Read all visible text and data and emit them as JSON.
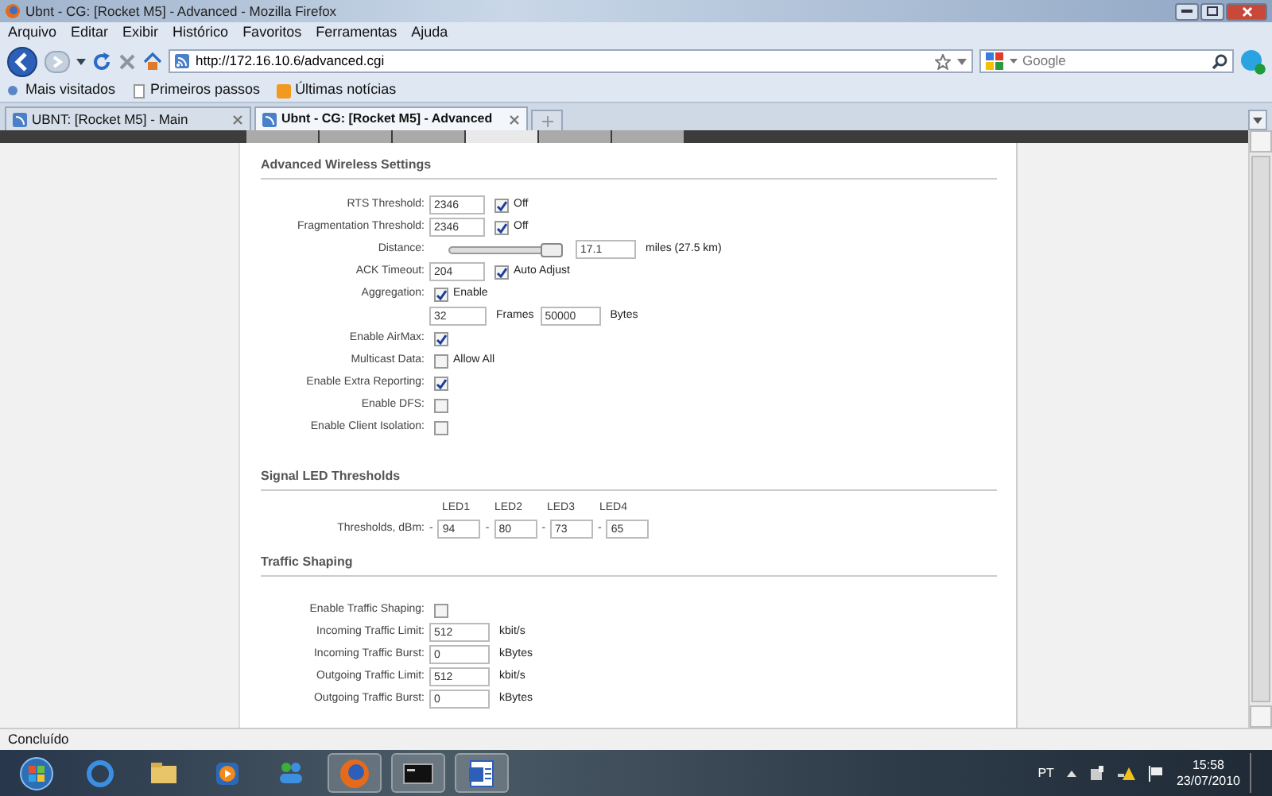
{
  "window": {
    "title": "Ubnt - CG: [Rocket M5] - Advanced - Mozilla Firefox"
  },
  "menu": [
    "Arquivo",
    "Editar",
    "Exibir",
    "Histórico",
    "Favoritos",
    "Ferramentas",
    "Ajuda"
  ],
  "navbar": {
    "url": "http://172.16.10.6/advanced.cgi",
    "search_placeholder": "Google"
  },
  "bookmarks": [
    "Mais visitados",
    "Primeiros passos",
    "Últimas notícias"
  ],
  "browser_tabs": [
    {
      "label": "UBNT: [Rocket M5] - Main",
      "selected": false
    },
    {
      "label": "Ubnt - CG: [Rocket M5] - Advanced",
      "selected": true
    }
  ],
  "page_tabs": [
    {
      "selected": false
    },
    {
      "selected": false
    },
    {
      "selected": false
    },
    {
      "selected": true
    },
    {
      "selected": false
    },
    {
      "selected": false
    }
  ],
  "advanced": {
    "title": "Advanced Wireless Settings",
    "rows": [
      {
        "kind": "input_check",
        "label": "RTS Threshold:",
        "value": "2346",
        "checked": true,
        "option": "Off"
      },
      {
        "kind": "input_check",
        "label": "Fragmentation Threshold:",
        "value": "2346",
        "checked": true,
        "option": "Off"
      },
      {
        "kind": "slider",
        "label": "Distance:",
        "level": 0.92,
        "value": "17.1",
        "unit": "miles (27.5 km)"
      },
      {
        "kind": "input_check",
        "label": "ACK Timeout:",
        "value": "204",
        "checked": true,
        "option": "Auto Adjust"
      },
      {
        "kind": "check",
        "label": "Aggregation:",
        "checked": true,
        "option": "Enable"
      },
      {
        "kind": "inputs",
        "items": [
          {
            "value": "32",
            "unit": "Frames"
          },
          {
            "value": "50000",
            "unit": "Bytes"
          }
        ]
      },
      {
        "kind": "check",
        "label": "Enable AirMax:",
        "checked": true
      },
      {
        "kind": "check",
        "label": "Multicast Data:",
        "checked": false,
        "option": "Allow All"
      },
      {
        "kind": "check",
        "label": "Enable Extra Reporting:",
        "checked": true
      },
      {
        "kind": "check",
        "label": "Enable DFS:",
        "checked": false
      },
      {
        "kind": "check",
        "label": "Enable Client Isolation:",
        "checked": false
      }
    ]
  },
  "led": {
    "title": "Signal LED Thresholds",
    "label": "Thresholds, dBm:",
    "leds": [
      {
        "header": "LED1",
        "sign": "-",
        "value": "94"
      },
      {
        "header": "LED2",
        "sign": "-",
        "value": "80"
      },
      {
        "header": "LED3",
        "sign": "-",
        "value": "73"
      },
      {
        "header": "LED4",
        "sign": "-",
        "value": "65"
      }
    ]
  },
  "traffic": {
    "title": "Traffic Shaping",
    "rows": [
      {
        "kind": "check",
        "label": "Enable Traffic Shaping:",
        "checked": false
      },
      {
        "kind": "input",
        "label": "Incoming Traffic Limit:",
        "value": "512",
        "unit": "kbit/s"
      },
      {
        "kind": "input",
        "label": "Incoming Traffic Burst:",
        "value": "0",
        "unit": "kBytes"
      },
      {
        "kind": "input",
        "label": "Outgoing Traffic Limit:",
        "value": "512",
        "unit": "kbit/s"
      },
      {
        "kind": "input",
        "label": "Outgoing Traffic Burst:",
        "value": "0",
        "unit": "kBytes"
      }
    ]
  },
  "status_bar": "Concluído",
  "taskbar": {
    "language": "PT",
    "time": "15:58",
    "date": "23/07/2010"
  }
}
